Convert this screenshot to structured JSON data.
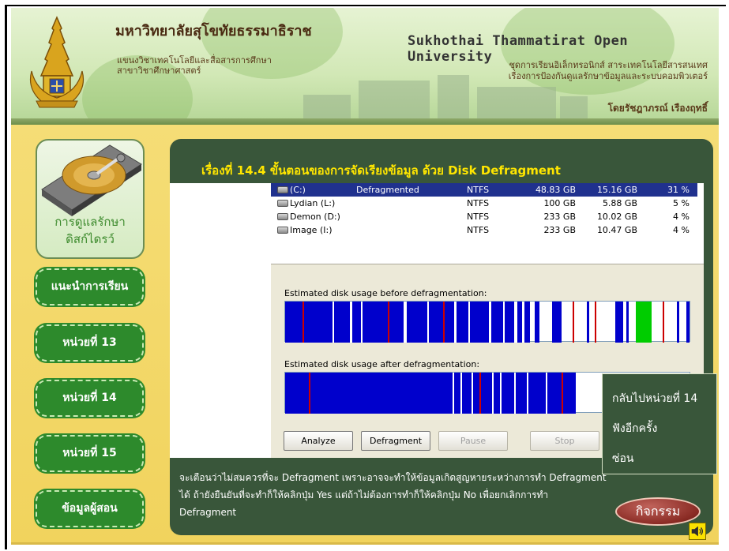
{
  "header": {
    "th_title": "มหาวิทยาลัยสุโขทัยธรรมาธิราช",
    "th_sub1": "แขนงวิชาเทคโนโลยีและสื่อสารการศึกษา",
    "th_sub2": "สาขาวิชาศึกษาศาสตร์",
    "en_title": "Sukhothai Thammatirat Open University",
    "r_sub1": "ชุดการเรียนอิเล็กทรอนิกส์ สาระเทคโนโลยีสารสนเทศ",
    "r_sub2": "เรื่องการป้องกันดูแลรักษาข้อมูลและระบบคอมพิวเตอร์",
    "author": "โดยรัชฎาภรณ์ เรืองฤทธิ์"
  },
  "sidebar": {
    "hdd_caption_1": "การดูแลรักษา",
    "hdd_caption_2": "ดิสก์ไดรว์",
    "items": [
      {
        "label": "แนะนำการเรียน"
      },
      {
        "label": "หน่วยที่ 13"
      },
      {
        "label": "หน่วยที่ 14"
      },
      {
        "label": "หน่วยที่ 15"
      },
      {
        "label": "ข้อมูลผู้สอน"
      }
    ]
  },
  "panel": {
    "title": "เรื่องที่ 14.4 ขั้นตอนของการจัดเรียงข้อมูล ด้วย Disk Defragment"
  },
  "volumes": [
    {
      "name": "(C:)",
      "status": "Defragmented",
      "fs": "NTFS",
      "capacity": "48.83 GB",
      "free": "15.16 GB",
      "pct": "31 %",
      "selected": true
    },
    {
      "name": "Lydian (L:)",
      "status": "",
      "fs": "NTFS",
      "capacity": "100 GB",
      "free": "5.88 GB",
      "pct": "5 %"
    },
    {
      "name": "Demon (D:)",
      "status": "",
      "fs": "NTFS",
      "capacity": "233 GB",
      "free": "10.02 GB",
      "pct": "4 %"
    },
    {
      "name": "Image (I:)",
      "status": "",
      "fs": "NTFS",
      "capacity": "233 GB",
      "free": "10.47 GB",
      "pct": "4 %"
    }
  ],
  "defrag": {
    "before_label": "Estimated disk usage before defragmentation:",
    "after_label": "Estimated disk usage after defragmentation:",
    "buttons": {
      "analyze": "Analyze",
      "defragment": "Defragment",
      "pause": "Pause",
      "stop": "Stop"
    }
  },
  "back_menu": {
    "item1": "กลับไปหน่วยที่ 14",
    "item2": "ฟังอีกครั้ง",
    "item3": "ซ่อน"
  },
  "description": {
    "line1": "จะเตือนว่าไม่สมควรที่จะ Defragment เพราะอาจจะทำให้ข้อมูลเกิดสูญหายระหว่างการทำ Defragment",
    "line2": "ได้ ถ้ายังยืนยันที่จะทำก็ให้คลิกปุ่ม Yes แต่ถ้าไม่ต้องการทำก็ให้คลิกปุ่ม No เพื่อยกเลิกการทำ",
    "line3": "Defragment"
  },
  "activity_button": "กิจกรรม",
  "colors": {
    "panel_bg": "#39563a",
    "stage_bg": "#f1d35d",
    "nav_btn": "#2d8a2c",
    "title_yellow": "#ffe600",
    "disk_blue": "#0000cc",
    "disk_red": "#cc0000",
    "disk_green": "#00cc00"
  },
  "icons": [
    "crest-icon",
    "hard-disk-icon",
    "drive-icon",
    "mouse-cursor-icon",
    "speaker-icon"
  ]
}
